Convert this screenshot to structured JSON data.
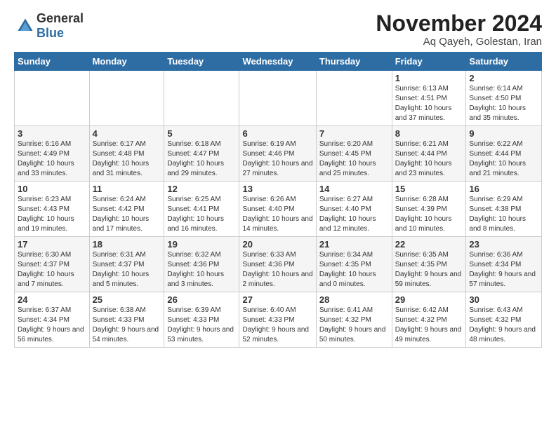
{
  "logo": {
    "general": "General",
    "blue": "Blue"
  },
  "header": {
    "month": "November 2024",
    "location": "Aq Qayeh, Golestan, Iran"
  },
  "days_of_week": [
    "Sunday",
    "Monday",
    "Tuesday",
    "Wednesday",
    "Thursday",
    "Friday",
    "Saturday"
  ],
  "weeks": [
    [
      {
        "day": "",
        "info": ""
      },
      {
        "day": "",
        "info": ""
      },
      {
        "day": "",
        "info": ""
      },
      {
        "day": "",
        "info": ""
      },
      {
        "day": "",
        "info": ""
      },
      {
        "day": "1",
        "info": "Sunrise: 6:13 AM\nSunset: 4:51 PM\nDaylight: 10 hours and 37 minutes."
      },
      {
        "day": "2",
        "info": "Sunrise: 6:14 AM\nSunset: 4:50 PM\nDaylight: 10 hours and 35 minutes."
      }
    ],
    [
      {
        "day": "3",
        "info": "Sunrise: 6:16 AM\nSunset: 4:49 PM\nDaylight: 10 hours and 33 minutes."
      },
      {
        "day": "4",
        "info": "Sunrise: 6:17 AM\nSunset: 4:48 PM\nDaylight: 10 hours and 31 minutes."
      },
      {
        "day": "5",
        "info": "Sunrise: 6:18 AM\nSunset: 4:47 PM\nDaylight: 10 hours and 29 minutes."
      },
      {
        "day": "6",
        "info": "Sunrise: 6:19 AM\nSunset: 4:46 PM\nDaylight: 10 hours and 27 minutes."
      },
      {
        "day": "7",
        "info": "Sunrise: 6:20 AM\nSunset: 4:45 PM\nDaylight: 10 hours and 25 minutes."
      },
      {
        "day": "8",
        "info": "Sunrise: 6:21 AM\nSunset: 4:44 PM\nDaylight: 10 hours and 23 minutes."
      },
      {
        "day": "9",
        "info": "Sunrise: 6:22 AM\nSunset: 4:44 PM\nDaylight: 10 hours and 21 minutes."
      }
    ],
    [
      {
        "day": "10",
        "info": "Sunrise: 6:23 AM\nSunset: 4:43 PM\nDaylight: 10 hours and 19 minutes."
      },
      {
        "day": "11",
        "info": "Sunrise: 6:24 AM\nSunset: 4:42 PM\nDaylight: 10 hours and 17 minutes."
      },
      {
        "day": "12",
        "info": "Sunrise: 6:25 AM\nSunset: 4:41 PM\nDaylight: 10 hours and 16 minutes."
      },
      {
        "day": "13",
        "info": "Sunrise: 6:26 AM\nSunset: 4:40 PM\nDaylight: 10 hours and 14 minutes."
      },
      {
        "day": "14",
        "info": "Sunrise: 6:27 AM\nSunset: 4:40 PM\nDaylight: 10 hours and 12 minutes."
      },
      {
        "day": "15",
        "info": "Sunrise: 6:28 AM\nSunset: 4:39 PM\nDaylight: 10 hours and 10 minutes."
      },
      {
        "day": "16",
        "info": "Sunrise: 6:29 AM\nSunset: 4:38 PM\nDaylight: 10 hours and 8 minutes."
      }
    ],
    [
      {
        "day": "17",
        "info": "Sunrise: 6:30 AM\nSunset: 4:37 PM\nDaylight: 10 hours and 7 minutes."
      },
      {
        "day": "18",
        "info": "Sunrise: 6:31 AM\nSunset: 4:37 PM\nDaylight: 10 hours and 5 minutes."
      },
      {
        "day": "19",
        "info": "Sunrise: 6:32 AM\nSunset: 4:36 PM\nDaylight: 10 hours and 3 minutes."
      },
      {
        "day": "20",
        "info": "Sunrise: 6:33 AM\nSunset: 4:36 PM\nDaylight: 10 hours and 2 minutes."
      },
      {
        "day": "21",
        "info": "Sunrise: 6:34 AM\nSunset: 4:35 PM\nDaylight: 10 hours and 0 minutes."
      },
      {
        "day": "22",
        "info": "Sunrise: 6:35 AM\nSunset: 4:35 PM\nDaylight: 9 hours and 59 minutes."
      },
      {
        "day": "23",
        "info": "Sunrise: 6:36 AM\nSunset: 4:34 PM\nDaylight: 9 hours and 57 minutes."
      }
    ],
    [
      {
        "day": "24",
        "info": "Sunrise: 6:37 AM\nSunset: 4:34 PM\nDaylight: 9 hours and 56 minutes."
      },
      {
        "day": "25",
        "info": "Sunrise: 6:38 AM\nSunset: 4:33 PM\nDaylight: 9 hours and 54 minutes."
      },
      {
        "day": "26",
        "info": "Sunrise: 6:39 AM\nSunset: 4:33 PM\nDaylight: 9 hours and 53 minutes."
      },
      {
        "day": "27",
        "info": "Sunrise: 6:40 AM\nSunset: 4:33 PM\nDaylight: 9 hours and 52 minutes."
      },
      {
        "day": "28",
        "info": "Sunrise: 6:41 AM\nSunset: 4:32 PM\nDaylight: 9 hours and 50 minutes."
      },
      {
        "day": "29",
        "info": "Sunrise: 6:42 AM\nSunset: 4:32 PM\nDaylight: 9 hours and 49 minutes."
      },
      {
        "day": "30",
        "info": "Sunrise: 6:43 AM\nSunset: 4:32 PM\nDaylight: 9 hours and 48 minutes."
      }
    ]
  ]
}
